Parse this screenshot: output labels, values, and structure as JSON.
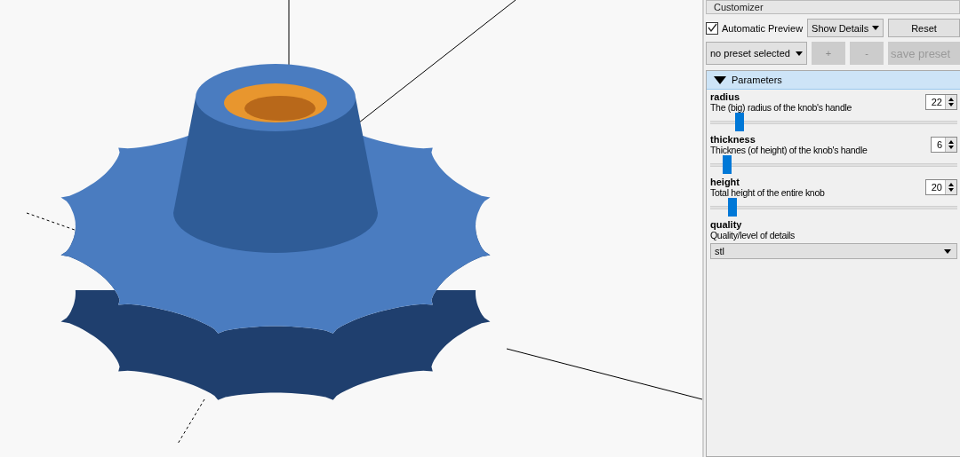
{
  "panel": {
    "title": "Customizer"
  },
  "toolbar": {
    "auto_preview": {
      "label": "Automatic Preview",
      "checked": true
    },
    "details": {
      "value": "Show Details"
    },
    "reset": {
      "label": "Reset"
    }
  },
  "presets": {
    "value": "no preset selected",
    "add": "+",
    "remove": "-",
    "save": {
      "label": "save preset",
      "disabled": true
    }
  },
  "parameters": {
    "title": "Parameters",
    "expanded": true,
    "items": [
      {
        "kind": "slider",
        "name": "radius",
        "description": "The (big) radius of the knob's handle",
        "value": "22",
        "level": 0.12
      },
      {
        "kind": "slider",
        "name": "thickness",
        "description": "Thicknes (of height) of the knob's handle",
        "value": "6",
        "level": 0.07
      },
      {
        "kind": "slider",
        "name": "height",
        "description": "Total height of the entire knob",
        "value": "20",
        "level": 0.09
      },
      {
        "kind": "dropdown",
        "name": "quality",
        "description": "Quality/level of details",
        "value": "stl"
      }
    ]
  }
}
